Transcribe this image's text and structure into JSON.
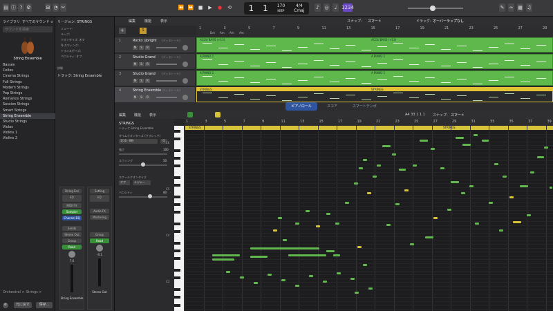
{
  "toolbar": {
    "lcd_bar": "1",
    "lcd_beat": "1",
    "tempo": "170",
    "tempo_label": "KEEP",
    "sig": "4/4",
    "key": "Cmaj",
    "badge": "1234"
  },
  "library": {
    "tab1": "ライブラリ",
    "tab2": "すべてのサウンド ≎",
    "search_placeholder": "サウンドを検索",
    "patch_name": "String Ensemble",
    "items": [
      "Basses",
      "Cellos",
      "Cinema Strings",
      "Full Strings",
      "Modern Strings",
      "Pop Strings",
      "Romance Strings",
      "Session Strings",
      "Smart Strings",
      "String Ensemble",
      "Studio Strings",
      "Violas",
      "Violins 1",
      "Violins 2"
    ],
    "selected_index": 9,
    "footer_path": "Orchestral > Strings >",
    "revert_btn": "元に戻す",
    "save_btn": "保存..."
  },
  "inspector": {
    "region_title": "リージョン: STRINGS",
    "mute_label": "ミュート:",
    "loop_label": "ループ:",
    "quantize_label": "クオンタイズ:",
    "quantize_val": "オフ",
    "q_strength": "Q-スウィング:",
    "transpose": "トランスポーズ:",
    "velocity": "ベロシティ: オフ",
    "more": "詳細",
    "track_label": "トラック: String Ensemble",
    "strip1": {
      "setting": "String Ens",
      "eq": "EQ",
      "midi": "MIDI FX",
      "instrument": "Sampler",
      "chan_eq": "Channel EQ",
      "sends": "Sends",
      "output": "Stereo Out",
      "group": "Group",
      "mode": "Read",
      "pan": "7.6",
      "name": "String Ensemble"
    },
    "strip2": {
      "setting": "Setting",
      "eq": "EQ",
      "audio": "Audio FX",
      "mastering": "Mastering",
      "group": "Group",
      "mode": "Read",
      "pan": "-0.1",
      "name": "Stereo Out"
    }
  },
  "tracks": {
    "edit": "編集",
    "func": "機能",
    "view": "表示",
    "snap_label": "スナップ:",
    "snap": "スマート",
    "drag_label": "ドラッグ:",
    "drag": "オーバーラップなし",
    "list": [
      {
        "num": "1",
        "name": "Rocks Upright",
        "type": "(ディストール)"
      },
      {
        "num": "2",
        "name": "Studio Grand",
        "type": "(ディストール)"
      },
      {
        "num": "3",
        "name": "Studio Grand",
        "type": "(ディストール)"
      },
      {
        "num": "4",
        "name": "String Ensemble",
        "type": "(ディストール)"
      }
    ],
    "regions": [
      {
        "track": 0,
        "label": "ACOU BASS (+13)",
        "label2": "ACOU BASS (+13)",
        "color": "#5fb84c"
      },
      {
        "track": 1,
        "label": "A.PIANO 1",
        "label2": "A.PIANO 1",
        "color": "#5fb84c"
      },
      {
        "track": 2,
        "label": "A.PIANO 1",
        "label2": "A.PIANO 1",
        "color": "#5fb84c"
      },
      {
        "track": 3,
        "label": "STRINGS",
        "label2": "STRINGS",
        "color": "#e0c232"
      }
    ],
    "ruler": [
      "1",
      "3",
      "5",
      "7",
      "9",
      "11",
      "13",
      "15",
      "17",
      "19",
      "21",
      "23",
      "25",
      "27",
      "29"
    ],
    "markers": [
      "Dm",
      "Am",
      "Am",
      "Am"
    ]
  },
  "piano": {
    "tabs": [
      "ピアノロール",
      "スコア",
      "スマートテンポ"
    ],
    "active_tab": 0,
    "edit": "編集",
    "func": "機能",
    "view": "表示",
    "position": "A4  33 1 1 1",
    "snap_label": "スナップ:",
    "snap": "スマート",
    "region_name": "STRINGS",
    "region_sub": "トラック String Ensemble",
    "time_quant_label": "タイムクオンタイズ (クラシック)",
    "time_quant": "1/16 - 8符",
    "strength_label": "強さ",
    "strength": "100",
    "swing_label": "スウィング",
    "swing": "50",
    "scale_label": "スケールクオンタイズ",
    "scale_off": "オフ",
    "scale_major": "メジャー",
    "velocity_label": "ベロシティ",
    "velocity": "80",
    "ruler": [
      "1",
      "3",
      "5",
      "7",
      "9",
      "11",
      "13",
      "15",
      "17",
      "19",
      "21",
      "23",
      "25",
      "27",
      "29",
      "31",
      "33",
      "35",
      "37",
      "39"
    ],
    "region_bar1": "STRINGS",
    "region_bar2": "STRINGS",
    "octaves": [
      "C6",
      "C5",
      "C4",
      "C3"
    ]
  },
  "colors": {
    "accent": "#2f55a0",
    "green": "#5fb84c",
    "yellow": "#e0c232",
    "note_green": "#62b84e",
    "note_yellow": "#d7c33a"
  }
}
